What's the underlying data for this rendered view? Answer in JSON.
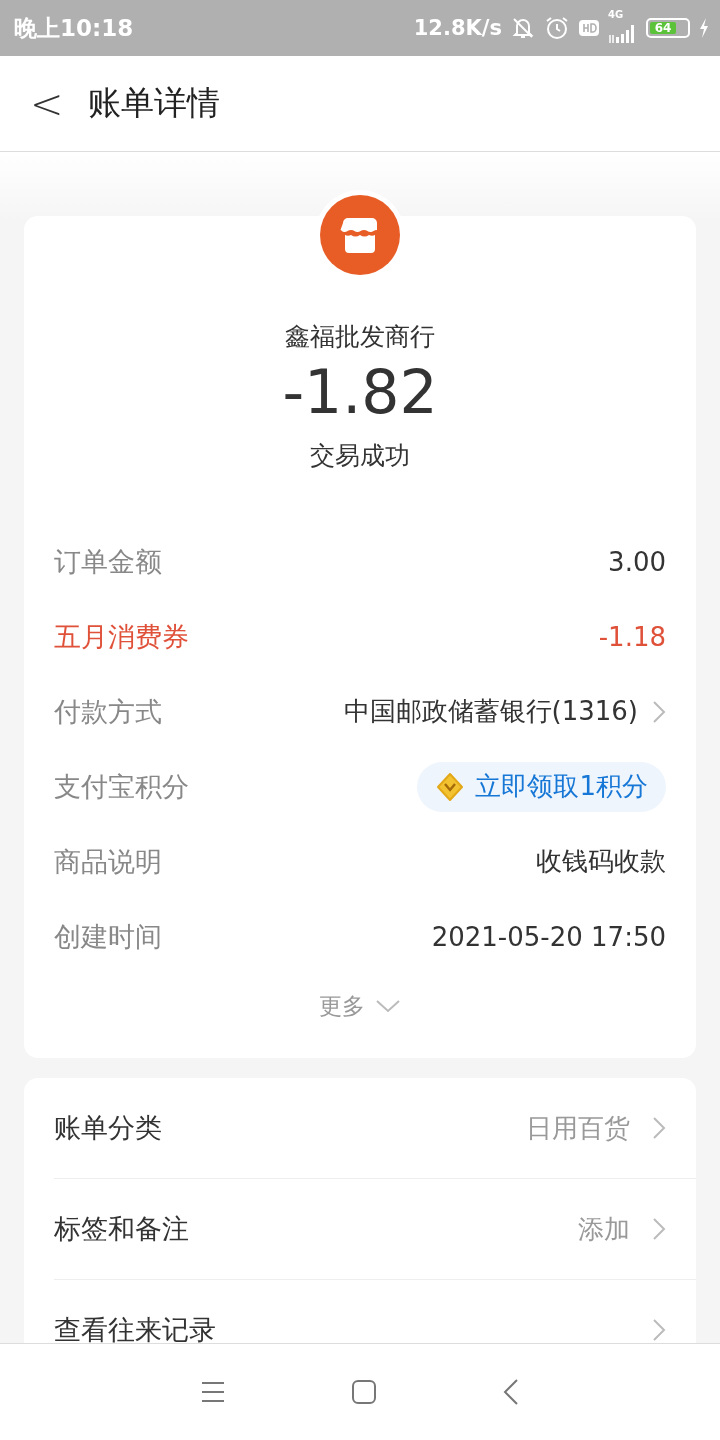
{
  "status_bar": {
    "time": "晚上10:18",
    "speed": "12.8K/s",
    "network": "4G",
    "battery": "64"
  },
  "header": {
    "back": "<",
    "title": "账单详情"
  },
  "summary": {
    "merchant": "鑫福批发商行",
    "amount": "-1.82",
    "status": "交易成功"
  },
  "details": [
    {
      "kind": "plain",
      "label": "订单金额",
      "value": "3.00",
      "highlight": false,
      "chevron": false
    },
    {
      "kind": "plain",
      "label": "五月消费券",
      "value": "-1.18",
      "highlight": true,
      "chevron": false
    },
    {
      "kind": "plain",
      "label": "付款方式",
      "value": "中国邮政储蓄银行(1316)",
      "highlight": false,
      "chevron": true
    },
    {
      "kind": "pill",
      "label": "支付宝积分",
      "value": "立即领取1积分",
      "highlight": false,
      "chevron": false
    },
    {
      "kind": "plain",
      "label": "商品说明",
      "value": "收钱码收款",
      "highlight": false,
      "chevron": false
    },
    {
      "kind": "plain",
      "label": "创建时间",
      "value": "2021-05-20 17:50",
      "highlight": false,
      "chevron": false
    }
  ],
  "more": "更多",
  "options": [
    {
      "label": "账单分类",
      "value": "日用百货"
    },
    {
      "label": "标签和备注",
      "value": "添加"
    },
    {
      "label": "查看往来记录"
    }
  ]
}
